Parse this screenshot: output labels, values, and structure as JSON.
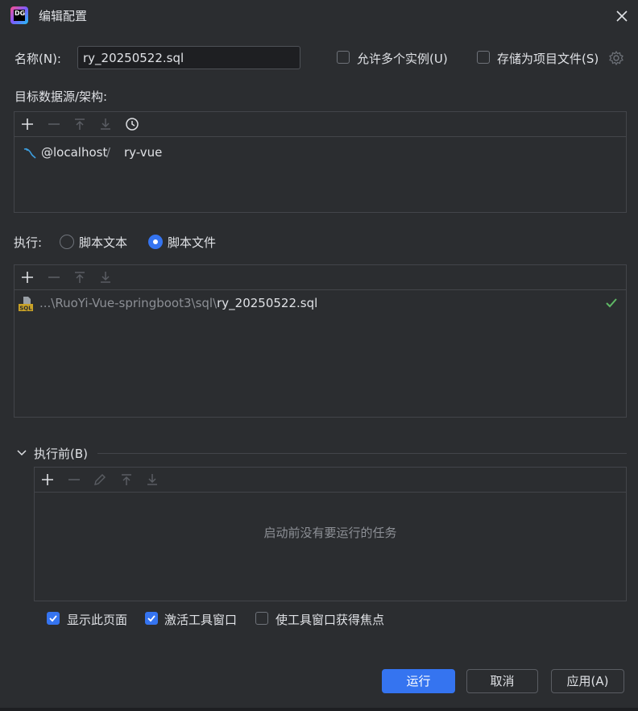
{
  "window": {
    "title": "编辑配置"
  },
  "name_row": {
    "label": "名称(N):",
    "value": "ry_20250522.sql",
    "allow_multiple_label": "允许多个实例(U)",
    "allow_multiple_checked": false,
    "store_as_project_label": "存储为项目文件(S)",
    "store_as_project_checked": false
  },
  "target": {
    "label": "目标数据源/架构:",
    "datasource": "@localhost",
    "separator": "/",
    "schema": "ry-vue"
  },
  "execute": {
    "label": "执行:",
    "options": [
      {
        "label": "脚本文本",
        "selected": false
      },
      {
        "label": "脚本文件",
        "selected": true
      }
    ]
  },
  "script_file": {
    "path_prefix": "...\\RuoYi-Vue-springboot3\\sql\\",
    "file_name": "ry_20250522.sql",
    "icon_label": "SQL"
  },
  "before_launch": {
    "label": "执行前(B)",
    "empty_message": "启动前没有要运行的任务"
  },
  "options": [
    {
      "label": "显示此页面",
      "checked": true
    },
    {
      "label": "激活工具窗口",
      "checked": true
    },
    {
      "label": "使工具窗口获得焦点",
      "checked": false
    }
  ],
  "buttons": {
    "run": "运行",
    "cancel": "取消",
    "apply": "应用(A)"
  },
  "colors": {
    "accent": "#3574f0",
    "background": "#2b2d30",
    "success": "#5fb865"
  }
}
